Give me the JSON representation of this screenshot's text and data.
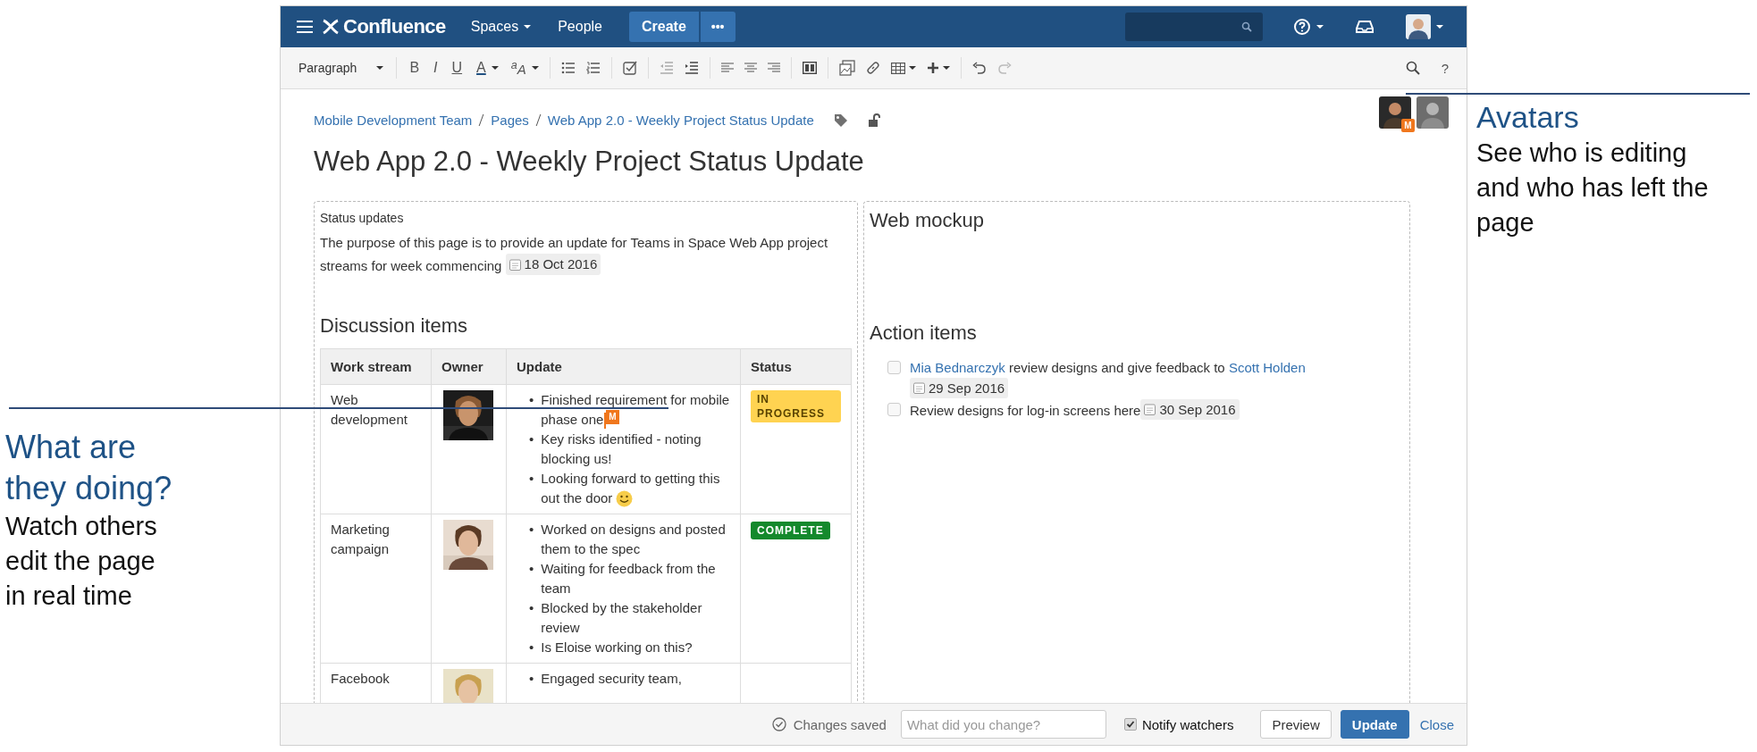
{
  "navbar": {
    "logo": "Confluence",
    "menus": [
      {
        "label": "Spaces",
        "dropdown": true
      },
      {
        "label": "People",
        "dropdown": false
      }
    ],
    "create": "Create",
    "more": "•••"
  },
  "toolbar": {
    "style": "Paragraph",
    "format": [
      "B",
      "I",
      "U",
      "A"
    ],
    "text_effects": "$^{a}$A",
    "help": "?"
  },
  "breadcrumbs": [
    "Mobile Development Team",
    "Pages",
    "Web App 2.0 - Weekly Project Status Update"
  ],
  "collaborators": [
    {
      "active": true,
      "badge": "M"
    },
    {
      "active": false
    }
  ],
  "title": "Web App 2.0 - Weekly Project Status Update",
  "left": {
    "label": "Status updates",
    "intro": "The purpose of this page is to provide an update for Teams in Space Web App project streams for week commencing",
    "date": "18 Oct 2016",
    "heading": "Discussion items",
    "table": {
      "bullet": "•",
      "columns": [
        "Work stream",
        "Owner",
        "Update",
        "Status"
      ],
      "rows": [
        {
          "work_stream": "Web development",
          "updates": [
            "Finished requirement for mobile phase one",
            "Key risks identified - noting blocking us!",
            "Looking forward to getting this out the door"
          ],
          "cursor": "M",
          "smiley_after_last": true,
          "status": {
            "kind": "in-progress",
            "label": "IN PROGRESS"
          }
        },
        {
          "work_stream": "Marketing campaign",
          "updates": [
            "Worked on designs and posted them to the spec",
            "Waiting for feedback from the team",
            "Blocked by the stakeholder review",
            "Is Eloise working on this?"
          ],
          "status": {
            "kind": "complete",
            "label": "COMPLETE"
          }
        },
        {
          "work_stream": "Facebook",
          "updates": [
            "Engaged security team,"
          ]
        }
      ]
    }
  },
  "right": {
    "heading": "Web mockup",
    "actions_heading": "Action items",
    "tasks": [
      {
        "checked": false,
        "parts": [
          {
            "kind": "mention",
            "text": "Mia Bednarczyk"
          },
          {
            "kind": "text",
            "text": " review designs and give feedback to "
          },
          {
            "kind": "mention",
            "text": "Scott Holden"
          }
        ],
        "date": "29 Sep 2016"
      },
      {
        "checked": false,
        "parts": [
          {
            "kind": "text",
            "text": "Review designs for log-in screens here"
          }
        ],
        "date": "30 Sep 2016"
      }
    ]
  },
  "footer": {
    "status": "Changes saved",
    "comment_placeholder": "What did you change?",
    "notify": {
      "label": "Notify watchers",
      "checked": true
    },
    "buttons": [
      {
        "kind": "secondary",
        "label": "Preview"
      },
      {
        "kind": "primary",
        "label": "Update"
      },
      {
        "kind": "link",
        "label": "Close"
      }
    ]
  },
  "annotations": [
    {
      "title": "Avatars",
      "text": "See who is editing and who has left the page"
    },
    {
      "title": "What are they doing?",
      "text": "Watch others edit the page in real time"
    }
  ]
}
